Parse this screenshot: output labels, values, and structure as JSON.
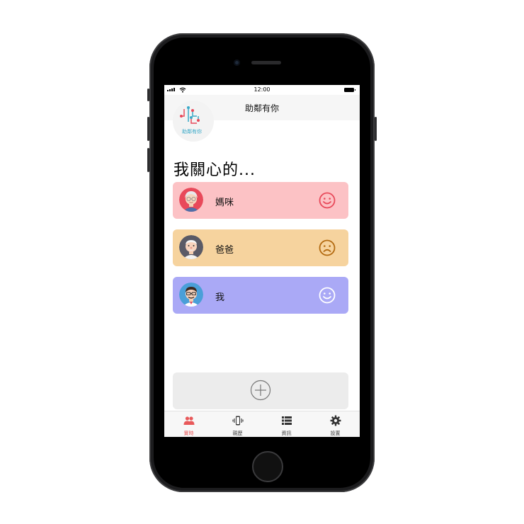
{
  "status_bar": {
    "time": "12:00"
  },
  "header": {
    "title": "助鄰有你"
  },
  "logo": {
    "text": "助鄰有你"
  },
  "main": {
    "heading": "我關心的...",
    "people": [
      {
        "name": "媽咪",
        "status": "happy",
        "color": "#fcc2c5",
        "face_color": "#e8495a"
      },
      {
        "name": "爸爸",
        "status": "sad",
        "color": "#f6d39e",
        "face_color": "#b36a10"
      },
      {
        "name": "我",
        "status": "happy",
        "color": "#aaa9f6",
        "face_color": "#ffffff"
      }
    ],
    "add_button": {
      "icon": "plus-circle-icon"
    }
  },
  "tabs": [
    {
      "label": "實時",
      "icon": "people-icon",
      "active": true
    },
    {
      "label": "親歷",
      "icon": "vibrate-phone-icon",
      "active": false
    },
    {
      "label": "資訊",
      "icon": "list-icon",
      "active": false
    },
    {
      "label": "設置",
      "icon": "gear-icon",
      "active": false
    }
  ],
  "colors": {
    "accent": "#e8595a"
  }
}
